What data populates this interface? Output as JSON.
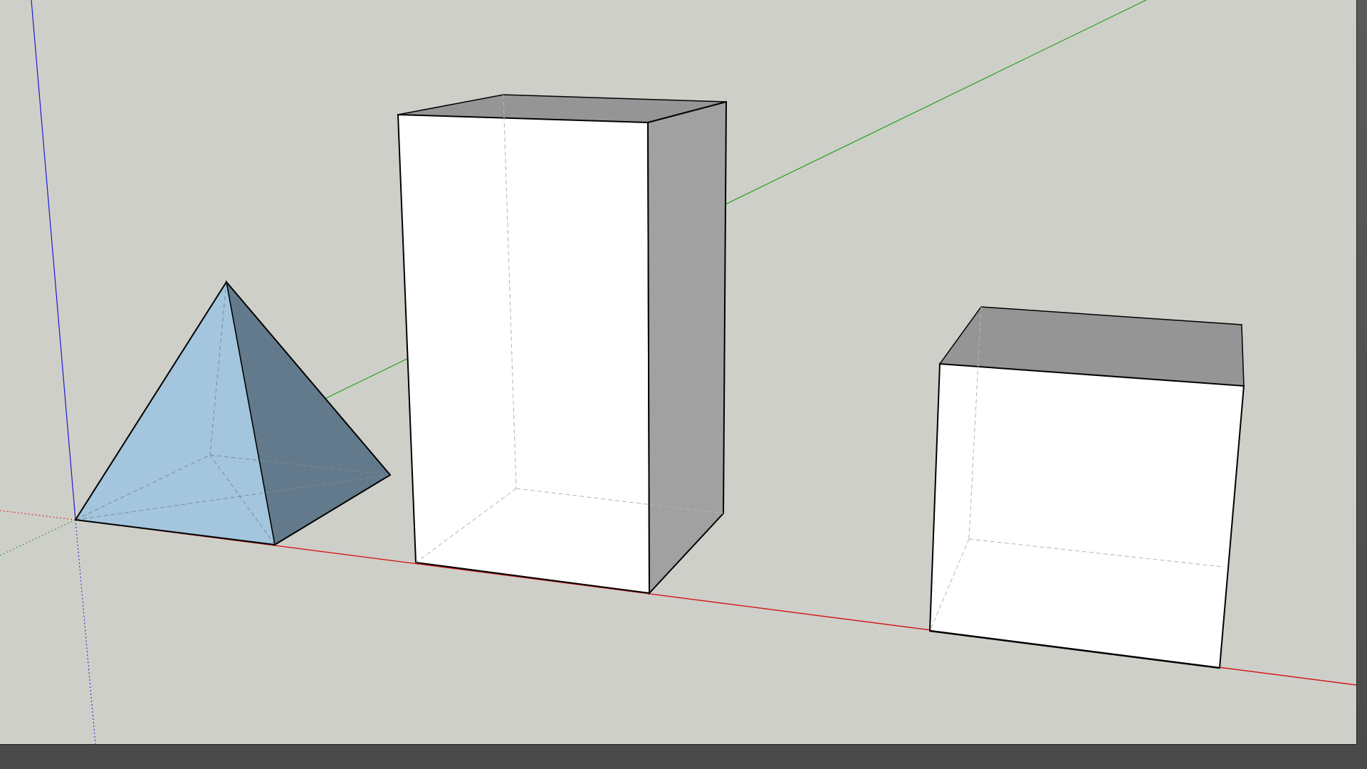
{
  "app": {
    "viewport_background": "#cfcfc9",
    "frame_color": "#4f4f4f"
  },
  "axes": {
    "red_axis_color": "#d11a1a",
    "green_axis_color": "#21a321",
    "blue_axis_color": "#1a1ad1"
  },
  "model": {
    "objects": [
      {
        "name": "pyramid",
        "front_face_color": "#a3c6de",
        "side_face_color": "#627a8b"
      },
      {
        "name": "tall-box",
        "front_face_color": "#ffffff",
        "side_face_color": "#a1a1a1",
        "top_face_color": "#959595"
      },
      {
        "name": "cube",
        "front_face_color": "#ffffff",
        "top_face_color": "#959595"
      }
    ]
  }
}
